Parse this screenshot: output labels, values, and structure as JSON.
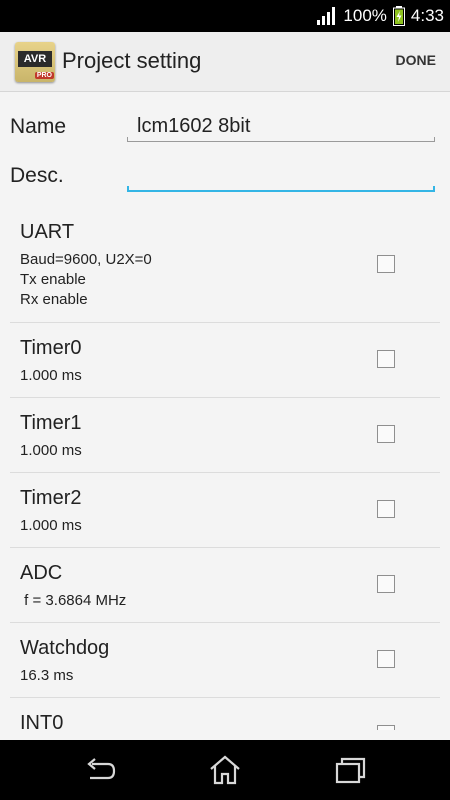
{
  "status_bar": {
    "battery": "100%",
    "time": "4:33",
    "icons": [
      "signal-icon",
      "battery-charging-icon"
    ]
  },
  "action_bar": {
    "app_icon_text": "AVR",
    "app_icon_badge": "PRO",
    "title": "Project setting",
    "done_label": "DONE"
  },
  "form": {
    "name_label": "Name",
    "name_value": "lcm1602 8bit",
    "desc_label": "Desc.",
    "desc_value": ""
  },
  "peripherals": [
    {
      "title": "UART",
      "detail": "Baud=9600, U2X=0\nTx enable\nRx enable",
      "checked": false
    },
    {
      "title": "Timer0",
      "detail": "1.000 ms",
      "checked": false
    },
    {
      "title": "Timer1",
      "detail": "1.000 ms",
      "checked": false
    },
    {
      "title": "Timer2",
      "detail": "1.000 ms",
      "checked": false
    },
    {
      "title": "ADC",
      "detail": " f = 3.6864 MHz",
      "checked": false
    },
    {
      "title": "Watchdog",
      "detail": "16.3 ms",
      "checked": false
    },
    {
      "title": "INT0",
      "detail": "",
      "checked": false
    }
  ],
  "nav_bar": {
    "icons": [
      "back-icon",
      "home-icon",
      "recent-apps-icon"
    ]
  },
  "colors": {
    "accent": "#33b5e5",
    "background": "#f4f4f4",
    "action_bar": "#eeeeee"
  }
}
